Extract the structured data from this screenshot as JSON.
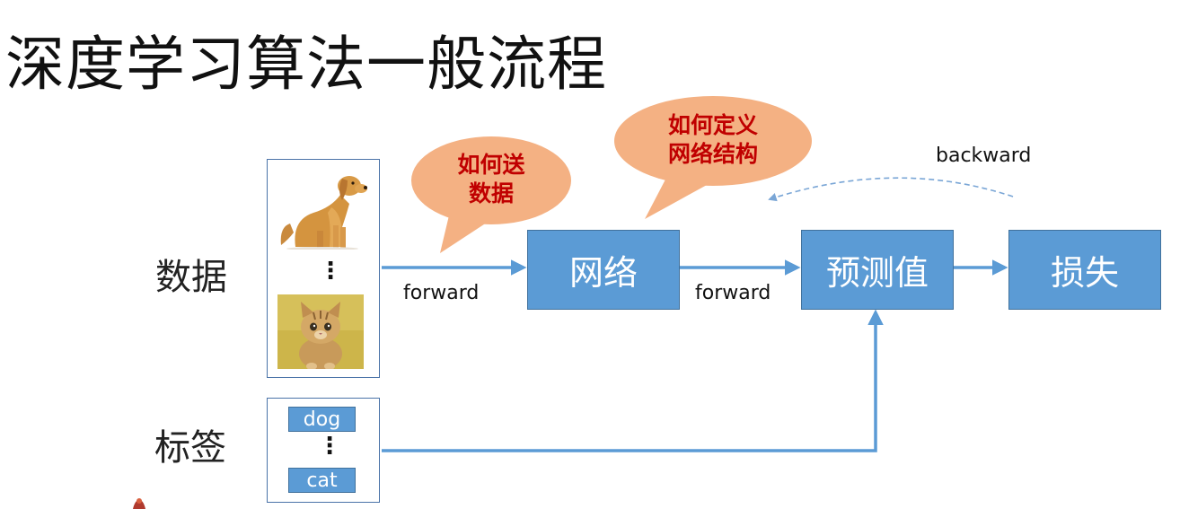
{
  "title": "深度学习算法一般流程",
  "row_labels": {
    "data": "数据",
    "labels": "标签"
  },
  "data_panel": {
    "ellipsis": "⋮",
    "images": [
      "dog-photo",
      "cat-photo"
    ]
  },
  "label_panel": {
    "tags": [
      "dog",
      "cat"
    ],
    "ellipsis": "⋮"
  },
  "nodes": {
    "network": "网络",
    "prediction": "预测值",
    "loss": "损失"
  },
  "edge_labels": {
    "forward_1": "forward",
    "forward_2": "forward",
    "backward": "backward"
  },
  "bubbles": {
    "feed_data": [
      "如何送",
      "数据"
    ],
    "define_network": [
      "如何定义",
      "网络结构"
    ]
  },
  "colors": {
    "node_fill": "#5b9bd5",
    "node_border": "#41719c",
    "arrow": "#5b9bd5",
    "bubble_fill": "#f4b183",
    "bubble_text": "#c00000",
    "backward_arrow": "#7aa6d6"
  }
}
